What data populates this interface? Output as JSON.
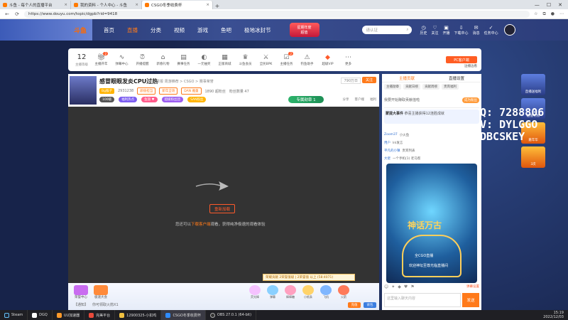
{
  "browser": {
    "tabs": [
      {
        "label": "斗鱼 - 每个人的直播平台",
        "active": false
      },
      {
        "label": "我的资料 - 个人中心 - 斗鱼",
        "active": false
      },
      {
        "label": "CSGO冬季收费杯",
        "active": true
      }
    ],
    "url": "https://www.douyu.com/topic/dgpb?rid=9418"
  },
  "header": {
    "logo": "斗鱼",
    "nav": [
      "首页",
      "直播",
      "分类",
      "视频",
      "游戏",
      "鱼吧",
      "极地冰封节"
    ],
    "active_nav": "直播",
    "promo_line1": "星期年度",
    "promo_line2": "超值",
    "search_placeholder": "请认证",
    "icons": [
      "历史",
      "关注",
      "开播",
      "下载中心",
      "消息",
      "任务中心"
    ]
  },
  "toolbar": {
    "level_num": "12",
    "level_label": "主播等级",
    "tools": [
      {
        "label": "主播开年",
        "badge": "2"
      },
      {
        "label": "弹幕中心",
        "badge": ""
      },
      {
        "label": "开播提醒",
        "badge": ""
      },
      {
        "label": "新春礼物",
        "badge": ""
      },
      {
        "label": "赛事任务",
        "badge": ""
      },
      {
        "label": "一元抽奖",
        "badge": ""
      },
      {
        "label": "正版商城",
        "badge": ""
      },
      {
        "label": "斗鱼会员",
        "badge": ""
      },
      {
        "label": "全民BPK",
        "badge": ""
      },
      {
        "label": "主播任务",
        "badge": "2"
      },
      {
        "label": "钓鱼助手",
        "badge": ""
      },
      {
        "label": "超级VIP",
        "badge": ""
      },
      {
        "label": "更多",
        "badge": ""
      }
    ],
    "pc_client": "PC客户端",
    "pc_sub": "边播边看"
  },
  "room": {
    "title": "感冒眼眼发炎CPU过热",
    "category": "举报  周游推荐 > CSGO > 赛事荣誉",
    "owner": "Bg猴子",
    "room_id": "2931238",
    "meta": [
      "1890 超粉丝",
      "粉丝数量 47"
    ],
    "tags": [
      "100级",
      "颜值担当",
      "新年全场",
      "DAN 雅童"
    ],
    "hot": "790万日",
    "follow": "关注",
    "fans_group": "专属勋章 1",
    "right": [
      "分享",
      "客户端",
      "福利"
    ]
  },
  "video": {
    "button": "重新加载",
    "msg_before": "您还可以",
    "msg_link": "下载客户端",
    "msg_after": "观看，获得纯净极速的观看体验"
  },
  "giftbar": {
    "left_items": [
      "荣誉中心",
      "极速大会"
    ],
    "gifts": [
      "荧光棒",
      "弹幕",
      "棒棒糖",
      "小纸条",
      "飞机",
      "火箭"
    ],
    "note": "荣耀贡献  2荣誉值级 | 2荣誉值 以上 (58:4071)",
    "bottom": [
      "【通知】",
      "你可领取火箭X1"
    ],
    "pay": "充值",
    "bag": "背包"
  },
  "rpanel": {
    "tabs": [
      "主播贡献",
      "直播设置"
    ],
    "active_tab": "主播贡献",
    "sub": [
      "主播勋章",
      "贡献日榜",
      "贡献周榜",
      "贵宾福利"
    ],
    "rank_left": "我要开始赚取贡献值啦",
    "rank_join": "成为粉丝",
    "event_title": "蒙提大事件",
    "event_text": "恭喜主播获得12连胜成就",
    "chat": [
      {
        "u": "Zoom37",
        "t": "小火鱼"
      },
      {
        "u": "用户",
        "t": "lnl发言"
      },
      {
        "u": "平凡的小镇",
        "t": "贵宾列表"
      },
      {
        "u": "大佬",
        "t": "一个手机(1) 老马帮"
      }
    ],
    "banner_title": "神话万古",
    "banner_line1": "全CGO直播",
    "banner_line2": "欢迎神坛至尊光临直播间",
    "tools": [
      "☺",
      "✦",
      "◆",
      "♥",
      "⚑"
    ],
    "tools_right": "弹幕设置",
    "input_placeholder": "这里输入聊天内容",
    "send": "发送"
  },
  "side": [
    "直播送福利",
    "超值礼物",
    "嘉年华",
    "3次"
  ],
  "overlay": [
    "Q: 7288806",
    "V: DYLGGO",
    "DBCSKEY"
  ],
  "taskbar": {
    "items": [
      {
        "label": "Steam",
        "color": "#1b2838"
      },
      {
        "label": "DGQ",
        "color": "#ffffff"
      },
      {
        "label": "UU加速器",
        "color": "#ff9a2a"
      },
      {
        "label": "完美平台",
        "color": "#e94a3b"
      },
      {
        "label": "12900325-小扣鸡",
        "color": "#f0c040"
      },
      {
        "label": "CSGO冬季收费杯",
        "color": "#2f8cff"
      },
      {
        "label": "OBS 27.0.1 (64-bit)",
        "color": "#333333"
      }
    ],
    "active_index": 5,
    "time": "15:19",
    "date": "2022/12/03"
  }
}
